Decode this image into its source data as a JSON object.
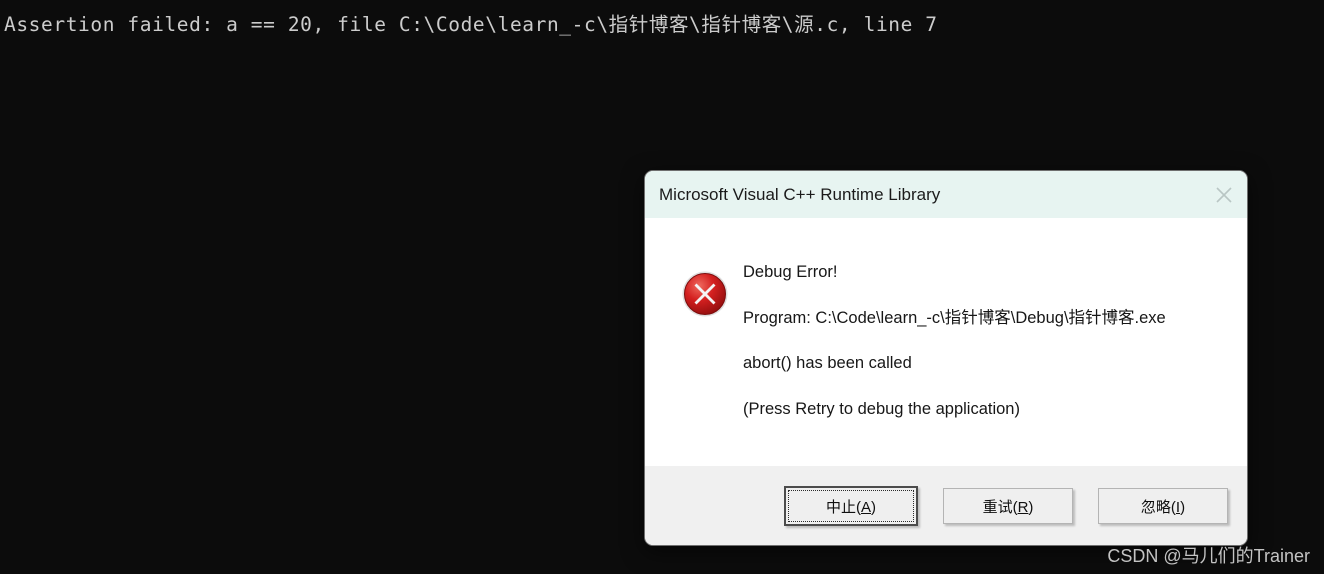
{
  "console": {
    "text": "Assertion failed: a == 20, file C:\\Code\\learn_-c\\指针博客\\指针博客\\源.c, line 7",
    "background_color": "#0c0c0c",
    "text_color": "#cccccc"
  },
  "dialog": {
    "title": "Microsoft Visual C++ Runtime Library",
    "titlebar_color": "#e7f4f1",
    "close_icon": "close-icon",
    "error_icon": "error-circle-x-icon",
    "error_icon_color": "#cf1c1c",
    "messages": [
      "Debug Error!",
      "Program: C:\\Code\\learn_-c\\指针博客\\Debug\\指针博客.exe",
      "abort() has been called",
      "(Press Retry to debug the application)"
    ],
    "buttons": [
      {
        "label": "中止(A)",
        "text_before": "中止(",
        "mnemonic": "A",
        "text_after": ")",
        "is_default": true
      },
      {
        "label": "重试(R)",
        "text_before": "重试(",
        "mnemonic": "R",
        "text_after": ")",
        "is_default": false
      },
      {
        "label": "忽略(I)",
        "text_before": "忽略(",
        "mnemonic": "I",
        "text_after": ")",
        "is_default": false
      }
    ]
  },
  "watermark": {
    "text": "CSDN @马儿们的Trainer"
  }
}
